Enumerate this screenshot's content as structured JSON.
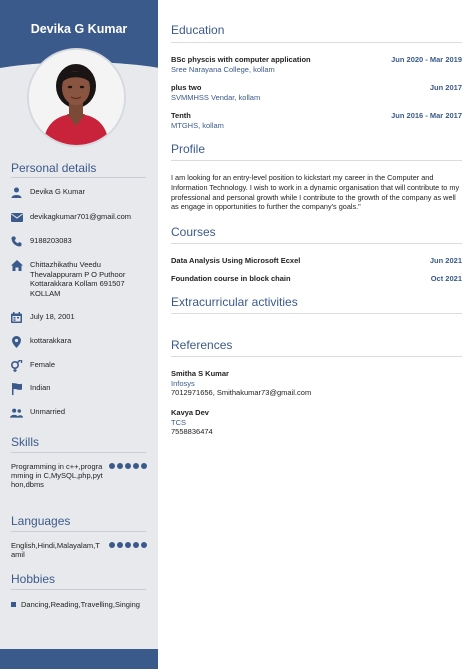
{
  "sidebar": {
    "name": "Devika G Kumar",
    "personal_title": "Personal details",
    "personal": [
      {
        "icon": "person-icon",
        "text": "Devika G Kumar"
      },
      {
        "icon": "envelope-icon",
        "text": "devikagkumar701@gmail.com"
      },
      {
        "icon": "phone-icon",
        "text": "9188203083"
      },
      {
        "icon": "home-icon",
        "text": "Chittazhikathu Veedu Thevalappuram P O Puthoor Kottarakkara Kollam 691507 KOLLAM"
      },
      {
        "icon": "calendar-icon",
        "text": "July 18, 2001"
      },
      {
        "icon": "location-pin-icon",
        "text": "kottarakkara"
      },
      {
        "icon": "gender-icon",
        "text": "Female"
      },
      {
        "icon": "flag-icon",
        "text": "Indian"
      },
      {
        "icon": "people-icon",
        "text": "Unmarried"
      }
    ],
    "skills_title": "Skills",
    "skills": [
      {
        "text": "Programming in c++,programming in C,MySQL,php,python,dbms",
        "level": 5
      }
    ],
    "languages_title": "Languages",
    "languages": [
      {
        "text": "English,Hindi,Malayalam,Tamil",
        "level": 5
      }
    ],
    "hobbies_title": "Hobbies",
    "hobbies": [
      "Dancing,Reading,Travelling,Singing"
    ]
  },
  "education": {
    "title": "Education",
    "items": [
      {
        "title": "BSc physcis with computer application",
        "date": "Jun 2020 - Mar 2019",
        "sub": "Sree Narayana College, kollam"
      },
      {
        "title": "plus two",
        "date": "Jun 2017",
        "sub": "SVMMHSS Vendar, kollam"
      },
      {
        "title": "Tenth",
        "date": "Jun 2016 - Mar 2017",
        "sub": "MTGHS, kollam"
      }
    ]
  },
  "profile": {
    "title": "Profile",
    "text": "I am looking for an entry-level position to kickstart my career in the Computer and Information Technology.  I wish to work in a dynamic organisation that will contribute to my professional and personal growth while I contribute to the growth of the company as well as engage in opportunities to further the company's goals.\""
  },
  "courses": {
    "title": "Courses",
    "items": [
      {
        "title": "Data Analysis Using Microsoft Ecxel",
        "date": "Jun 2021"
      },
      {
        "title": "Foundation course in block chain",
        "date": "Oct 2021"
      }
    ]
  },
  "extracurricular": {
    "title": "Extracurricular activities"
  },
  "references": {
    "title": "References",
    "items": [
      {
        "name": "Smitha S Kumar",
        "company": "Infosys",
        "contact": "7012971656, Smithakumar73@gmail.com"
      },
      {
        "name": "Kavya Dev",
        "company": "TCS",
        "contact": "7558836474"
      }
    ]
  },
  "colors": {
    "accent": "#3b5a8c",
    "sidebar_bg": "#e8e9ec"
  }
}
